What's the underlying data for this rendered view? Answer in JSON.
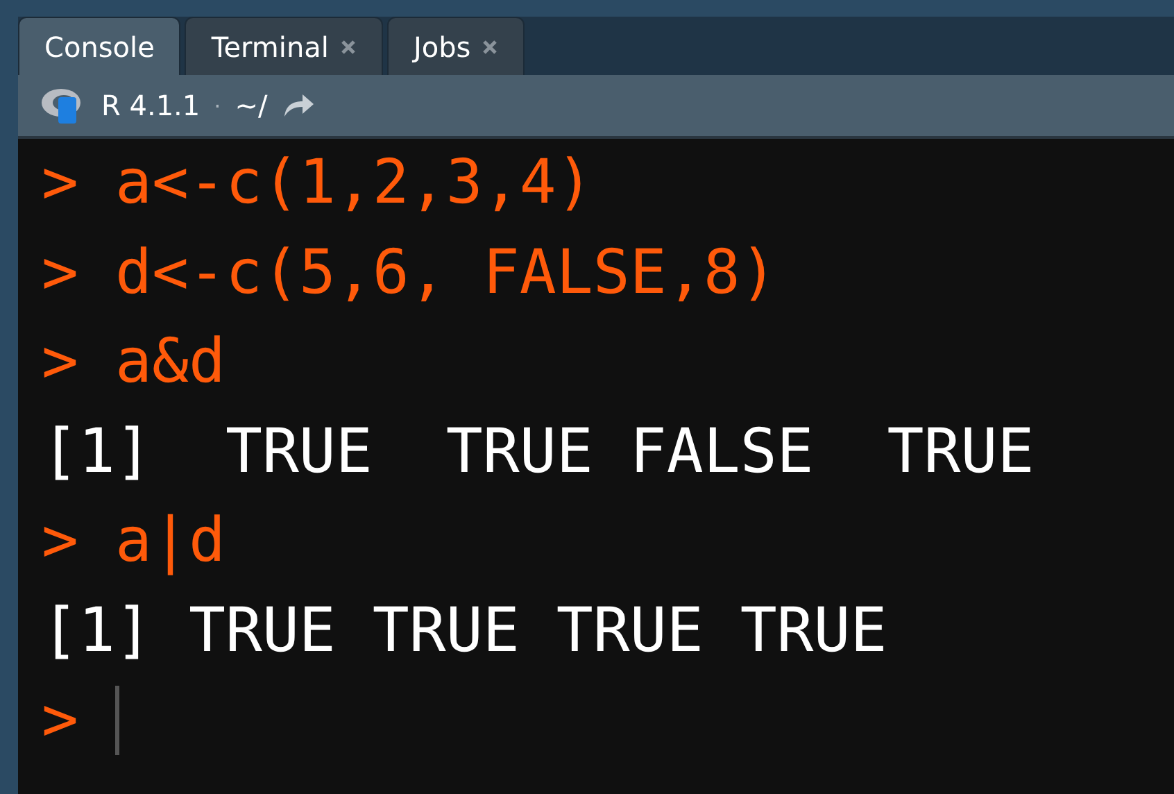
{
  "tabs": [
    {
      "label": "Console",
      "selected": true,
      "closable": false
    },
    {
      "label": "Terminal",
      "selected": false,
      "closable": true
    },
    {
      "label": "Jobs",
      "selected": false,
      "closable": true
    }
  ],
  "toolbar": {
    "version": "R 4.1.1",
    "separator": "·",
    "path": "~/"
  },
  "console": {
    "lines": [
      {
        "kind": "input",
        "prompt": ">",
        "code": "a<-c(1,2,3,4)"
      },
      {
        "kind": "input",
        "prompt": ">",
        "code": "d<-c(5,6, FALSE,8)"
      },
      {
        "kind": "input",
        "prompt": ">",
        "code": "a&d"
      },
      {
        "kind": "output",
        "text": "[1]  TRUE  TRUE FALSE  TRUE"
      },
      {
        "kind": "input",
        "prompt": ">",
        "code": "a|d"
      },
      {
        "kind": "output",
        "text": "[1] TRUE TRUE TRUE TRUE"
      },
      {
        "kind": "cursor",
        "prompt": ">"
      }
    ]
  }
}
